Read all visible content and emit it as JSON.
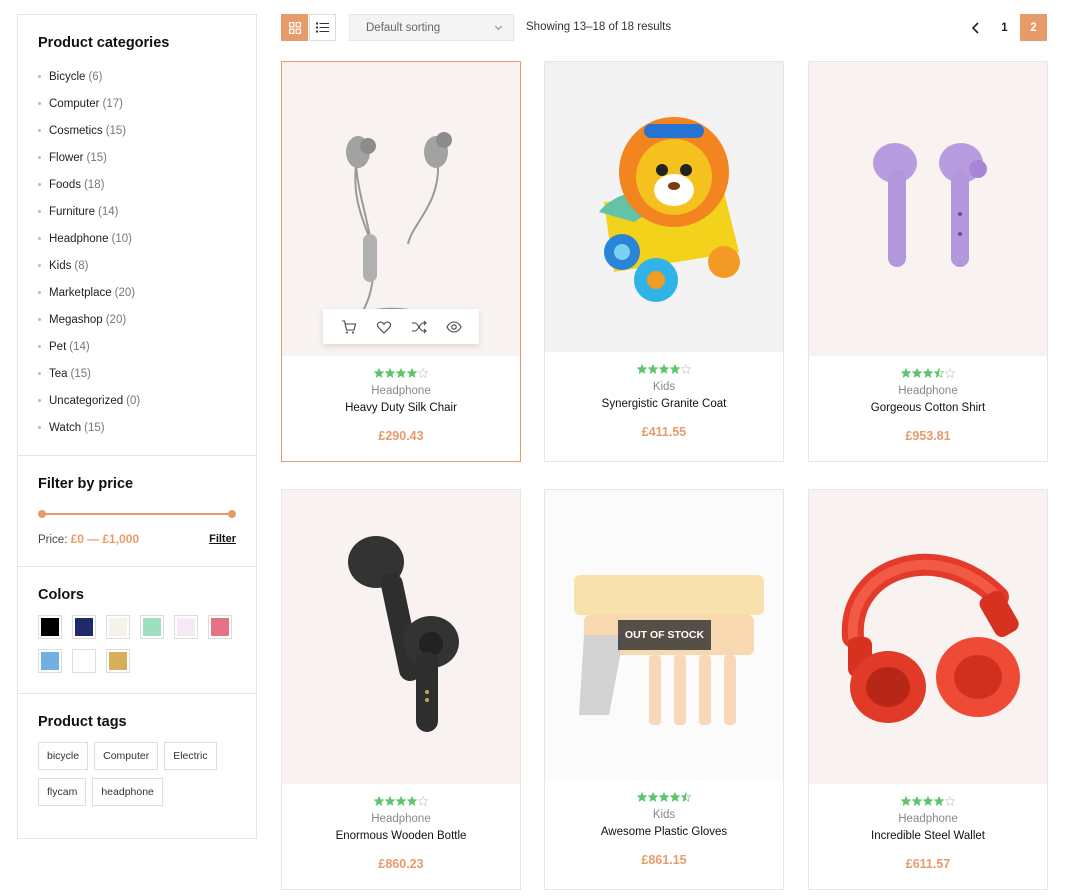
{
  "sidebar": {
    "categories": {
      "title": "Product categories",
      "items": [
        {
          "name": "Bicycle",
          "count": "(6)"
        },
        {
          "name": "Computer",
          "count": "(17)"
        },
        {
          "name": "Cosmetics",
          "count": "(15)"
        },
        {
          "name": "Flower",
          "count": "(15)"
        },
        {
          "name": "Foods",
          "count": "(18)"
        },
        {
          "name": "Furniture",
          "count": "(14)"
        },
        {
          "name": "Headphone",
          "count": "(10)"
        },
        {
          "name": "Kids",
          "count": "(8)"
        },
        {
          "name": "Marketplace",
          "count": "(20)"
        },
        {
          "name": "Megashop",
          "count": "(20)"
        },
        {
          "name": "Pet",
          "count": "(14)"
        },
        {
          "name": "Tea",
          "count": "(15)"
        },
        {
          "name": "Uncategorized",
          "count": "(0)"
        },
        {
          "name": "Watch",
          "count": "(15)"
        }
      ]
    },
    "price_filter": {
      "title": "Filter by price",
      "label": "Price:",
      "min": "£0",
      "separator": "—",
      "max": "£1,000",
      "button": "Filter"
    },
    "colors": {
      "title": "Colors",
      "items": [
        "#000000",
        "#1f2a6b",
        "#f5f2ea",
        "#9ee0bd",
        "#f5e9f5",
        "#e57285",
        "#6fb0e1",
        "#ffffff",
        "#d8ad5c"
      ]
    },
    "tags": {
      "title": "Product tags",
      "items": [
        "bicycle",
        "Computer",
        "Electric",
        "flycam",
        "headphone"
      ]
    }
  },
  "toolbar": {
    "sort_label": "Default sorting",
    "result_count": "Showing 13–18 of 18 results",
    "pages": [
      "1",
      "2"
    ],
    "current_page": "2"
  },
  "products": [
    {
      "category": "Headphone",
      "name": "Heavy Duty Silk Chair",
      "price": "£290.43",
      "rating": 4,
      "image": "earphones-gray",
      "hovered": true
    },
    {
      "category": "Kids",
      "name": "Synergistic Granite Coat",
      "price": "£411.55",
      "rating": 4,
      "image": "toy-lion-walker"
    },
    {
      "category": "Headphone",
      "name": "Gorgeous Cotton Shirt",
      "price": "£953.81",
      "rating": 3.5,
      "image": "earbuds-purple"
    },
    {
      "category": "Headphone",
      "name": "Enormous Wooden Bottle",
      "price": "£860.23",
      "rating": 4,
      "image": "earbuds-black"
    },
    {
      "category": "Kids",
      "name": "Awesome Plastic Gloves",
      "price": "£861.15",
      "rating": 4.5,
      "image": "toy-blaster",
      "badge": "OUT OF STOCK"
    },
    {
      "category": "Headphone",
      "name": "Incredible Steel Wallet",
      "price": "£611.57",
      "rating": 4,
      "image": "headphones-red"
    }
  ],
  "accent_color": "#e89b6a",
  "star_color": "#5ec46d"
}
